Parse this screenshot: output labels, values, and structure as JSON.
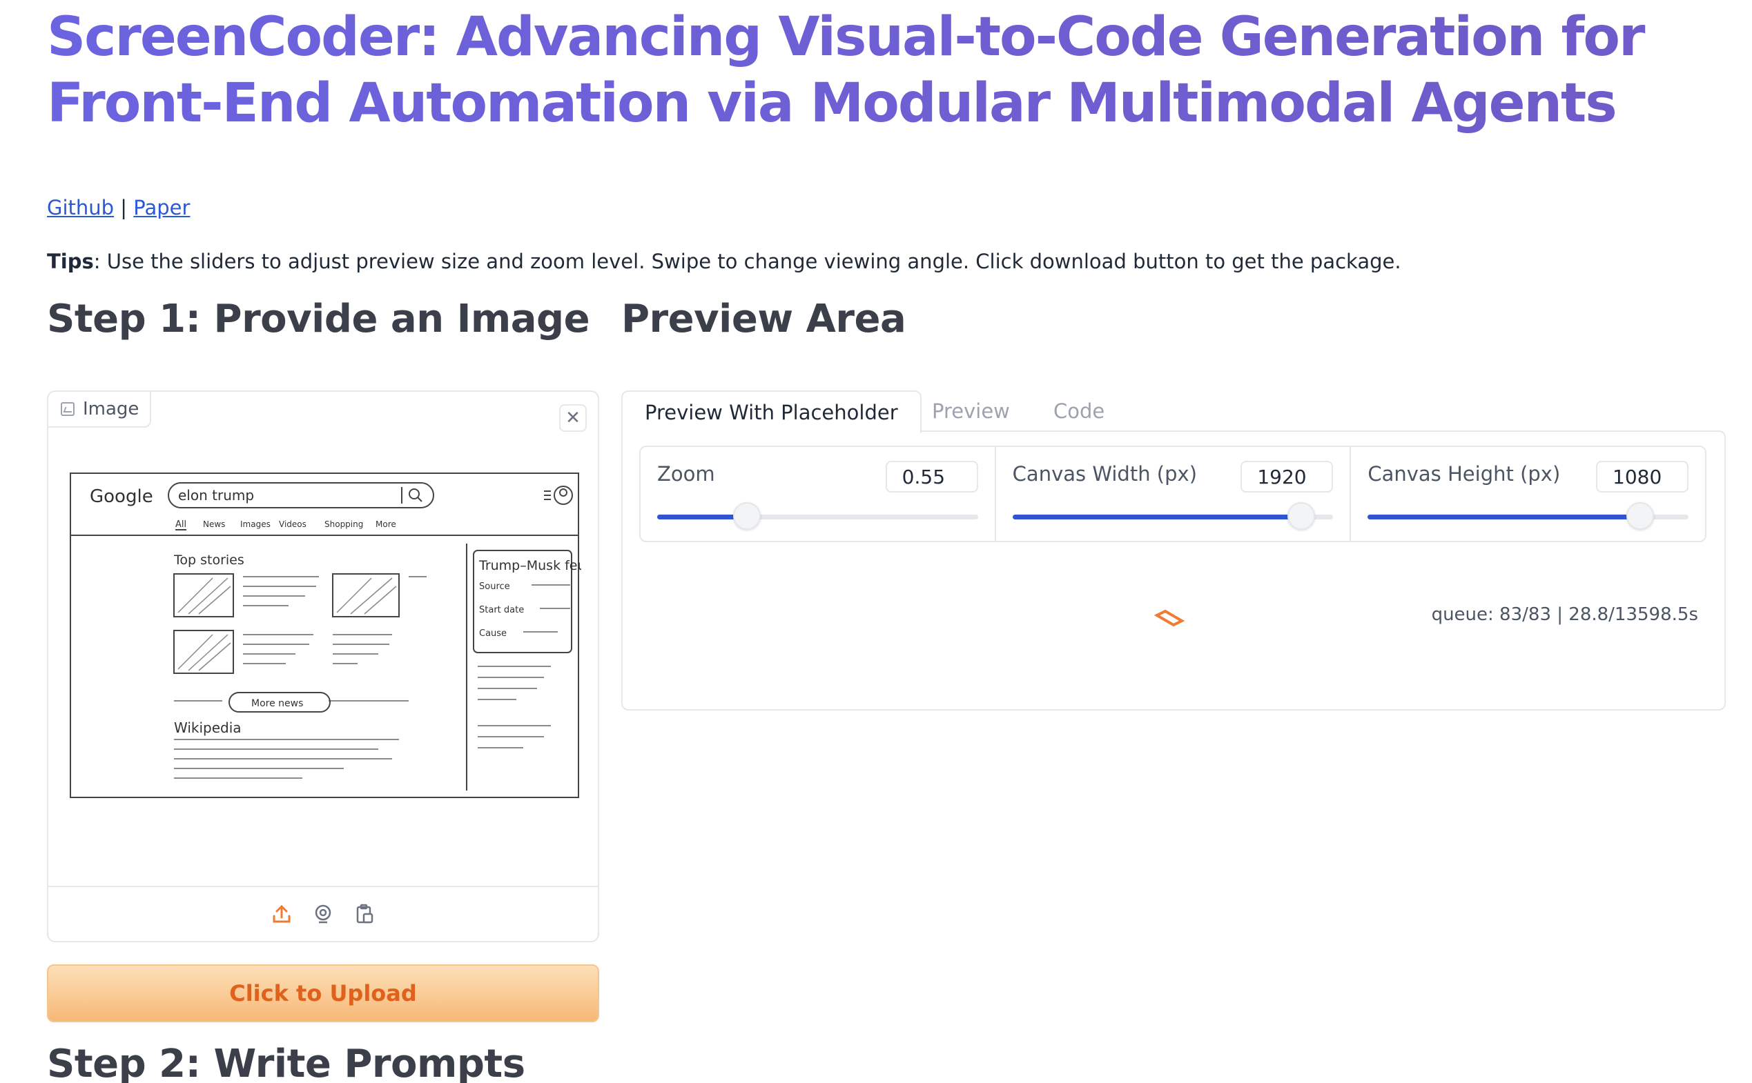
{
  "header": {
    "title_line1": "ScreenCoder: Advancing Visual-to-Code Generation for",
    "title_line2": "Front-End Automation via Modular Multimodal Agents",
    "link_github": "Github",
    "link_separator": "|",
    "link_paper": "Paper",
    "tips_label": "Tips",
    "tips_text": ": Use the sliders to adjust preview size and zoom level. Swipe to change viewing angle. Click download button to get the package."
  },
  "step1": {
    "heading": "Step 1: Provide an Image",
    "image_label": "Image",
    "close_symbol": "✕",
    "upload_button": "Click to Upload",
    "toolbar_icons": [
      "upload-icon",
      "webcam-icon",
      "clipboard-icon"
    ],
    "sketch": {
      "logo": "Google",
      "query": "elon trump",
      "nav": [
        "All",
        "News",
        "Images",
        "Videos",
        "Shopping",
        "More"
      ],
      "top_stories": "Top stories",
      "more_news": "More news",
      "wikipedia": "Wikipedia",
      "panel_title": "Trump–Musk feud",
      "panel_rows": [
        "Source",
        "Start date",
        "Cause"
      ]
    }
  },
  "step2": {
    "heading": "Step 2: Write Prompts"
  },
  "preview": {
    "heading": "Preview Area",
    "tabs": [
      "Preview With Placeholder",
      "Preview",
      "Code"
    ],
    "active_tab": 0,
    "sliders": [
      {
        "label": "Zoom",
        "value": "0.55",
        "fraction": 0.28
      },
      {
        "label": "Canvas Width (px)",
        "value": "1920",
        "fraction": 0.9
      },
      {
        "label": "Canvas Height (px)",
        "value": "1080",
        "fraction": 0.85
      }
    ],
    "queue_text": "queue: 83/83 | 28.8/13598.5s",
    "accent_color": "#2f55d4",
    "spinner_color": "#f07b32"
  }
}
